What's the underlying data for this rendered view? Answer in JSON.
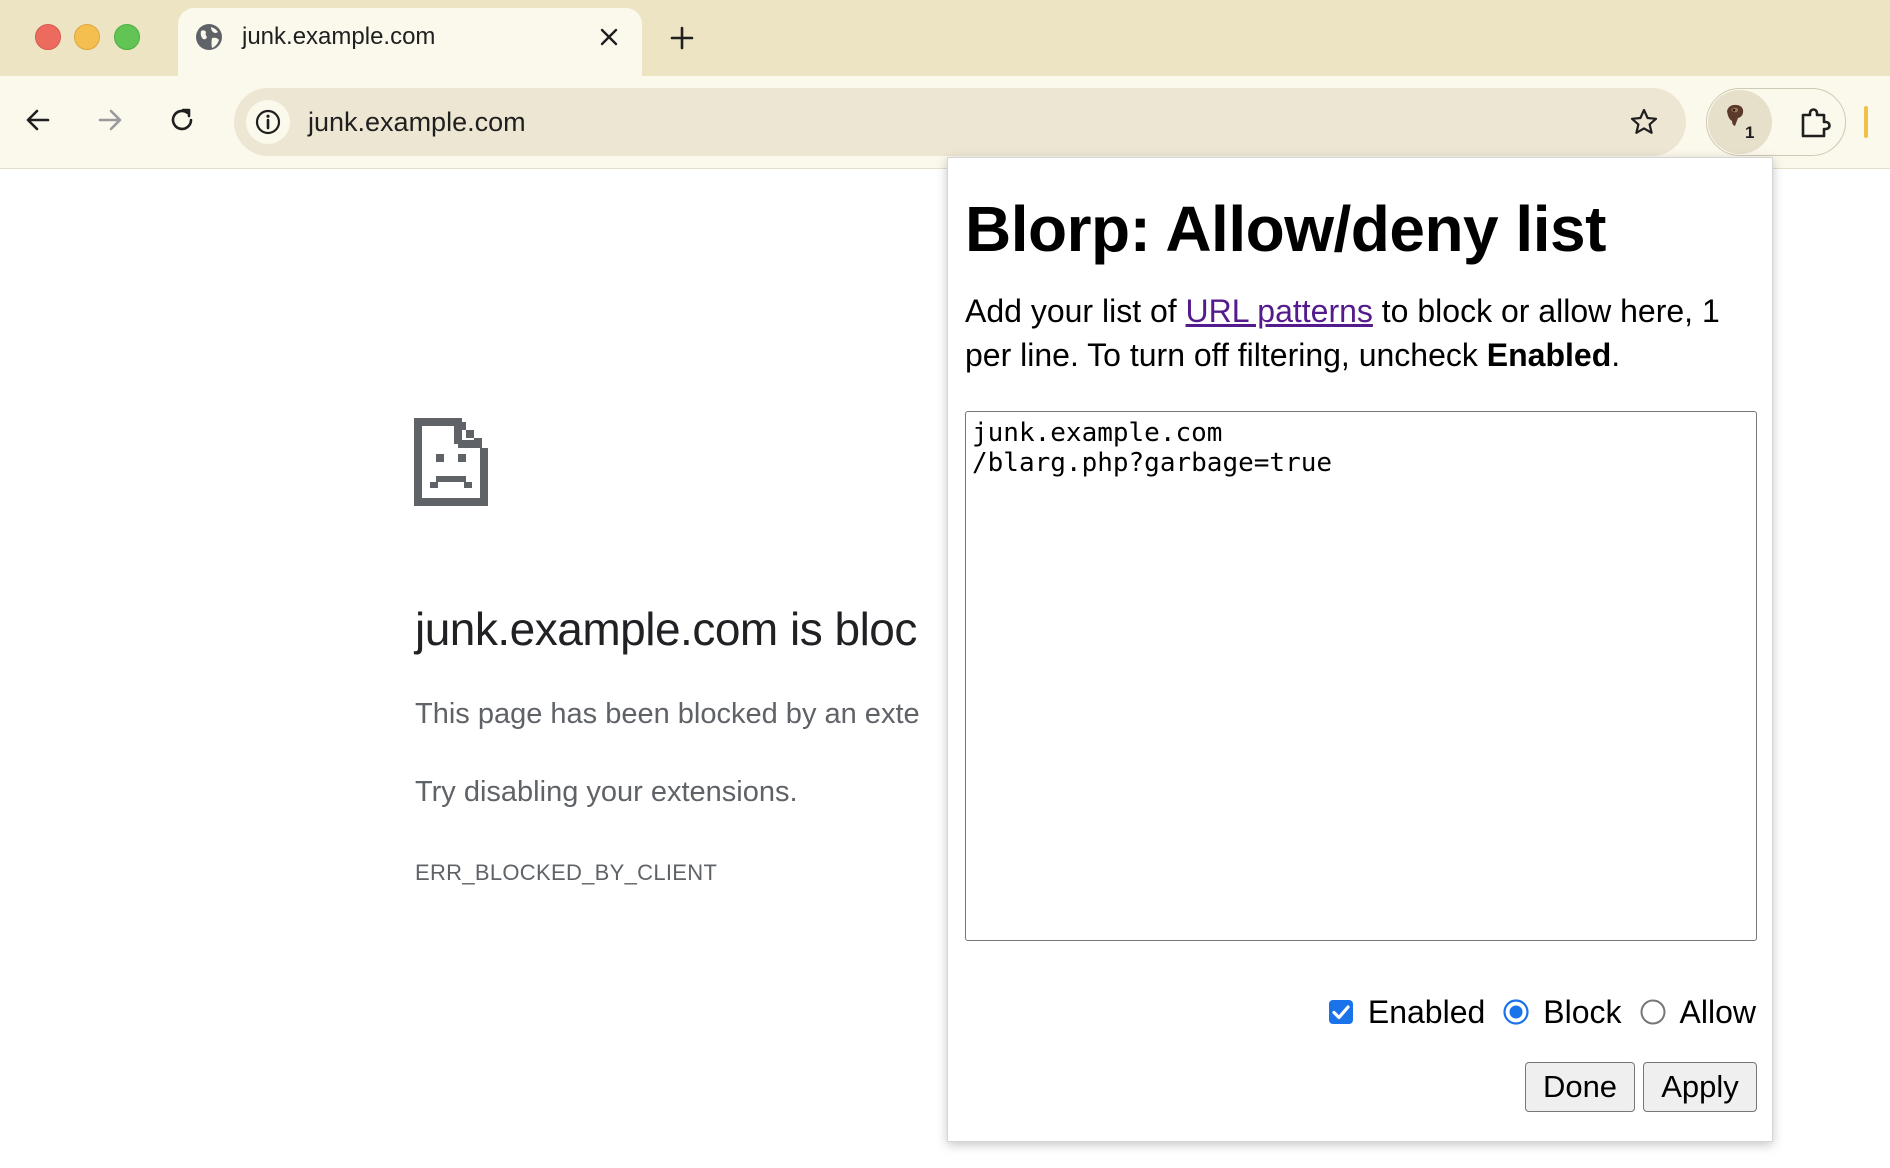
{
  "tab": {
    "title": "junk.example.com",
    "favicon": "globe-icon"
  },
  "toolbar": {
    "url": "junk.example.com",
    "extension_badge": "1"
  },
  "error": {
    "title": "junk.example.com is bloc",
    "line1": "This page has been blocked by an exte",
    "line2": "Try disabling your extensions.",
    "code": "ERR_BLOCKED_BY_CLIENT"
  },
  "popup": {
    "title": "Blorp: Allow/deny list",
    "desc_before": "Add your list of ",
    "desc_link": "URL patterns",
    "desc_middle": " to block or allow here, 1 per line. To turn off filtering, uncheck ",
    "desc_bold": "Enabled",
    "desc_after": ".",
    "patterns": "junk.example.com\n/blarg.php?garbage=true",
    "enabled_label": "Enabled",
    "enabled_checked": true,
    "block_label": "Block",
    "allow_label": "Allow",
    "mode_selected": "Block",
    "done_label": "Done",
    "apply_label": "Apply"
  },
  "colors": {
    "tabstrip": "#ede4c3",
    "toolbar": "#fbf8ec",
    "link": "#551a8b",
    "accent": "#1a73e8"
  }
}
